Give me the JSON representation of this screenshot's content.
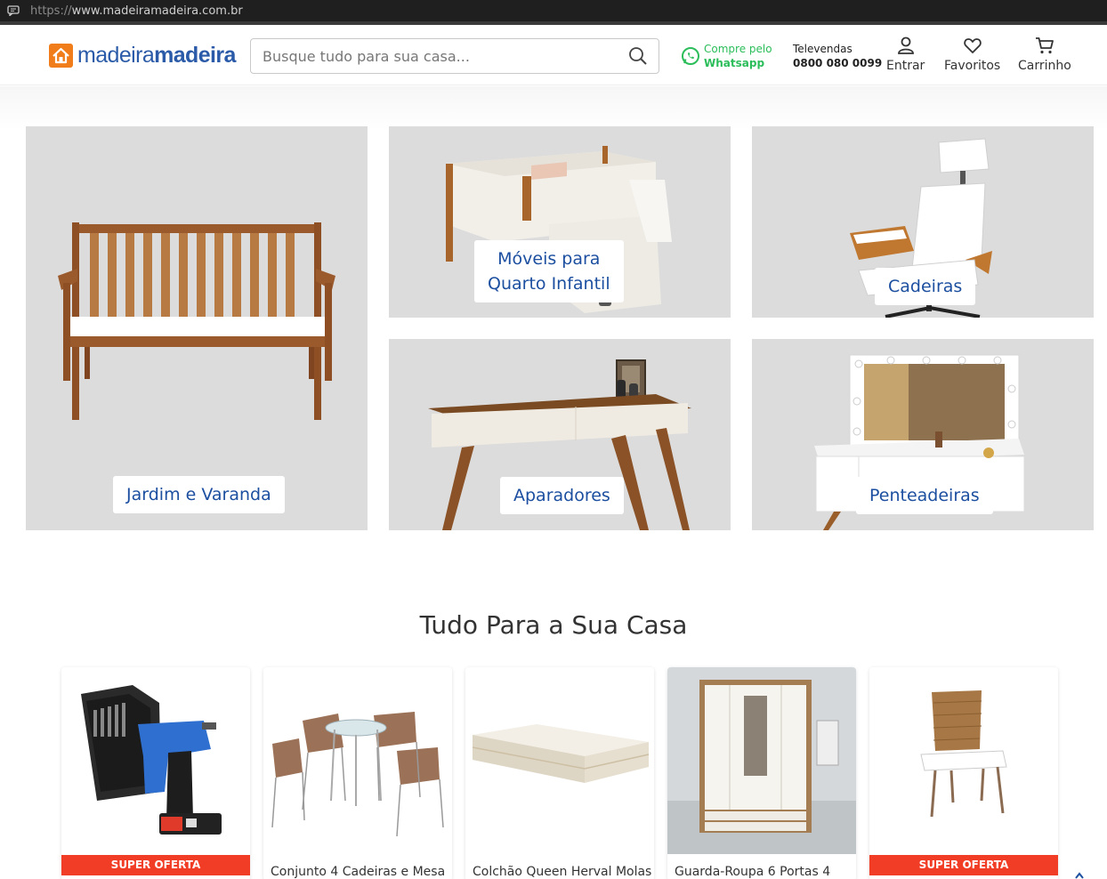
{
  "browser": {
    "url_scheme": "https://",
    "url_rest": "www.madeiramadeira.com.br"
  },
  "header": {
    "logo_light": "madeira",
    "logo_bold": "madeira",
    "search_placeholder": "Busque tudo para sua casa...",
    "whatsapp_line1": "Compre pelo",
    "whatsapp_line2": "Whatsapp",
    "televendas_label": "Televendas",
    "televendas_number": "0800 080 0099",
    "login_label": "Entrar",
    "favorites_label": "Favoritos",
    "cart_label": "Carrinho"
  },
  "categories": [
    {
      "label": "Jardim e Varanda"
    },
    {
      "label_line1": "Móveis para",
      "label_line2": "Quarto Infantil"
    },
    {
      "label": "Cadeiras"
    },
    {
      "label": "Aparadores"
    },
    {
      "label": "Penteadeiras"
    }
  ],
  "section_title": "Tudo Para a Sua Casa",
  "products": [
    {
      "badge": "SUPER OFERTA",
      "name": ""
    },
    {
      "badge": "",
      "name": "Conjunto 4 Cadeiras e Mesa"
    },
    {
      "badge": "",
      "name": "Colchão Queen Herval Molas"
    },
    {
      "badge": "",
      "name": "Guarda-Roupa 6 Portas 4"
    },
    {
      "badge": "SUPER OFERTA",
      "name": ""
    }
  ],
  "colors": {
    "brand_blue": "#2b5ba8",
    "brand_orange": "#f07d1a",
    "whatsapp_green": "#2bbd5a",
    "tile_bg": "#dcdcdc",
    "label_blue": "#1c4fa0",
    "offer_red": "#f23d26"
  },
  "icons": [
    "chat-icon",
    "search-icon",
    "whatsapp-icon",
    "user-icon",
    "heart-icon",
    "cart-icon"
  ]
}
